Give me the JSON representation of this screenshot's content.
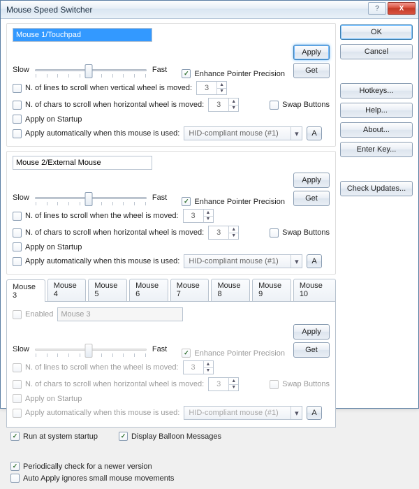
{
  "window": {
    "title": "Mouse Speed Switcher",
    "help_btn": "?",
    "close_btn": "X"
  },
  "side": {
    "ok": "OK",
    "cancel": "Cancel",
    "hotkeys": "Hotkeys...",
    "help": "Help...",
    "about": "About...",
    "enterkey": "Enter Key...",
    "check": "Check Updates..."
  },
  "common": {
    "slow": "Slow",
    "fast": "Fast",
    "apply": "Apply",
    "get": "Get",
    "enhance": "Enhance Pointer Precision",
    "swap": "Swap Buttons",
    "apply_startup": "Apply on Startup",
    "auto_apply": "Apply automatically when this mouse is used:",
    "hid": "HID-compliant mouse (#1)",
    "a": "A",
    "enabled": "Enabled"
  },
  "group1": {
    "name": "Mouse 1/Touchpad",
    "vscroll_label": "N. of lines to scroll when vertical wheel is moved:",
    "hscroll_label": "N. of chars to scroll when  horizontal wheel is moved:",
    "vscroll_val": "3",
    "hscroll_val": "3",
    "enhance_checked": true,
    "slider_pct": 48
  },
  "group2": {
    "name": "Mouse 2/External Mouse",
    "vscroll_label": "N. of lines to scroll when the wheel is moved:",
    "hscroll_label": "N. of chars to scroll when  horizontal wheel is moved:",
    "vscroll_val": "3",
    "hscroll_val": "3",
    "enhance_checked": true,
    "slider_pct": 48
  },
  "tabs": [
    "Mouse 3",
    "Mouse 4",
    "Mouse 5",
    "Mouse 6",
    "Mouse 7",
    "Mouse 8",
    "Mouse 9",
    "Mouse 10"
  ],
  "tabpage": {
    "name": "Mouse 3",
    "vscroll_label": "N. of lines to scroll when the wheel is moved:",
    "hscroll_label": "N. of chars to scroll when  horizontal wheel is moved:",
    "vscroll_val": "3",
    "hscroll_val": "3",
    "enhance_checked": true,
    "enabled_checked": false,
    "slider_pct": 48
  },
  "bottom": {
    "run_startup": "Run at system startup",
    "balloon": "Display Balloon Messages",
    "periodic": "Periodically check for a newer version",
    "auto_apply_ignore": "Auto Apply ignores small mouse movements"
  }
}
